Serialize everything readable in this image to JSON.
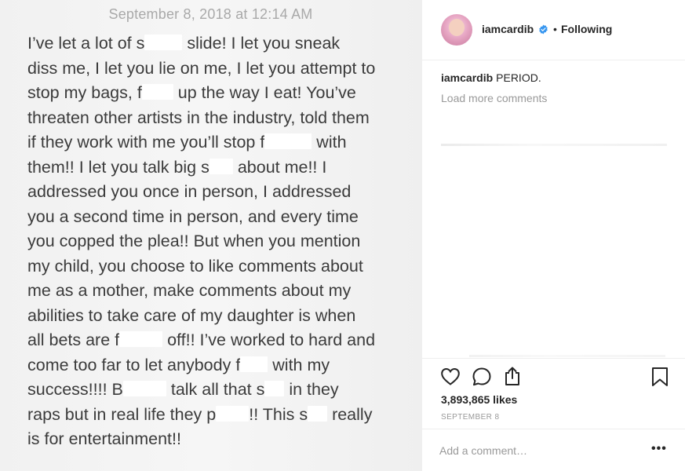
{
  "note": {
    "date": "September 8, 2018 at 12:14 AM",
    "lines": [
      [
        {
          "t": "I’ve let a lot of s"
        },
        {
          "c": 48
        },
        {
          "t": " slide! I let you sneak"
        }
      ],
      [
        {
          "t": "diss me, I let you lie on me, I let you attempt to"
        }
      ],
      [
        {
          "t": "stop my bags, f"
        },
        {
          "c": 40
        },
        {
          "t": " up the way I eat! You’ve"
        }
      ],
      [
        {
          "t": "threaten other artists in the industry, told them"
        }
      ],
      [
        {
          "t": "if they work with me you’ll stop f"
        },
        {
          "c": 60
        },
        {
          "t": " with"
        }
      ],
      [
        {
          "t": "them!! I let you talk big s"
        },
        {
          "c": 30
        },
        {
          "t": " about me!! I"
        }
      ],
      [
        {
          "t": "addressed you once in person, I addressed"
        }
      ],
      [
        {
          "t": "you a second time in person, and every time"
        }
      ],
      [
        {
          "t": "you copped the plea!! But when you mention"
        }
      ],
      [
        {
          "t": "my child, you choose to like comments about"
        }
      ],
      [
        {
          "t": "me as a mother, make comments about my"
        }
      ],
      [
        {
          "t": "abilities to take care of my daughter is when"
        }
      ],
      [
        {
          "t": "all bets are f"
        },
        {
          "c": 55
        },
        {
          "t": " off!! I’ve worked to hard and"
        }
      ],
      [
        {
          "t": "come too far to let anybody f"
        },
        {
          "c": 35
        },
        {
          "t": " with my"
        }
      ],
      [
        {
          "t": "success!!!! B"
        },
        {
          "c": 55
        },
        {
          "t": " talk all that s"
        },
        {
          "c": 25
        },
        {
          "t": " in they"
        }
      ],
      [
        {
          "t": "raps but in real life they p"
        },
        {
          "c": 42
        },
        {
          "t": "!! This s"
        },
        {
          "c": 25
        },
        {
          "t": " really"
        }
      ],
      [
        {
          "t": "is for entertainment!!"
        }
      ]
    ]
  },
  "header": {
    "username": "iamcardib",
    "dot": "•",
    "follow_status": "Following"
  },
  "caption": {
    "username": "iamcardib",
    "text": "PERIOD."
  },
  "load_more": "Load more comments",
  "likes": "3,893,865 likes",
  "date": "SEPTEMBER 8",
  "comment_input": {
    "placeholder": "Add a comment…"
  },
  "more_label": "•••",
  "colors": {
    "verified": "#3897f0",
    "text": "#262626",
    "muted": "#999999"
  },
  "icons": [
    "verified-icon",
    "heart-icon",
    "comment-icon",
    "share-icon",
    "bookmark-icon",
    "more-options-icon"
  ]
}
